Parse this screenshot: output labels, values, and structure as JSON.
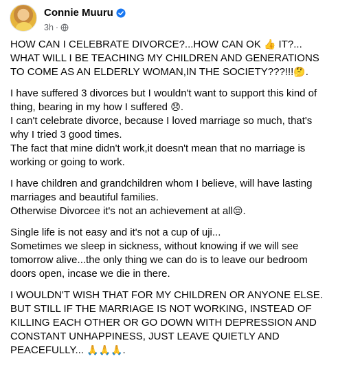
{
  "author": {
    "name": "Connie Muuru",
    "time": "3h",
    "separator": "·",
    "avatar_icon": "profile-photo",
    "verified_icon": "verified-badge-icon",
    "privacy_icon": "globe-icon",
    "verified_color": "#1877f2"
  },
  "post": {
    "p1": {
      "a": "HOW CAN I CELEBRATE DIVORCE?...HOW CAN OK",
      "e1": "👍",
      "b": " IT?... WHAT WILL I BE TEACHING MY CHILDREN AND GENERATIONS TO COME AS AN ELDERLY WOMAN,IN THE SOCIETY???!!!",
      "e2": "🤔",
      "c": "."
    },
    "p2": {
      "l1": "I have suffered 3 divorces but I wouldn't want to support this kind of thing, bearing in my how I suffered",
      "e1": "😞",
      "l1_end": ".",
      "l2": "I can't celebrate divorce, because I loved marriage so much, that's why I tried 3 good times.",
      "l3": "The fact that mine didn't work,it doesn't mean that no marriage is working or going to work."
    },
    "p3": {
      "l1": "I have children and grandchildren whom I believe, will have lasting marriages and beautiful families.",
      "l2": "Otherwise Divorcee it's not an achievement at all",
      "e1": "😔",
      "l2_end": "."
    },
    "p4": {
      "l1": "Single life is not easy and it's not a cup of uji...",
      "l2": "Sometimes we sleep in sickness, without knowing if we will see tomorrow alive...the only thing we can do is to leave our bedroom doors open, incase we die in there."
    },
    "p5": {
      "l1": "I WOULDN'T WISH THAT FOR MY CHILDREN OR ANYONE ELSE.",
      "l2": "BUT STILL IF THE MARRIAGE IS NOT WORKING, INSTEAD OF KILLING EACH OTHER OR GO DOWN WITH DEPRESSION AND CONSTANT UNHAPPINESS, JUST LEAVE QUIETLY AND PEACEFULLY... ",
      "e1": "🙏🙏🙏",
      "l2_end": "."
    }
  }
}
